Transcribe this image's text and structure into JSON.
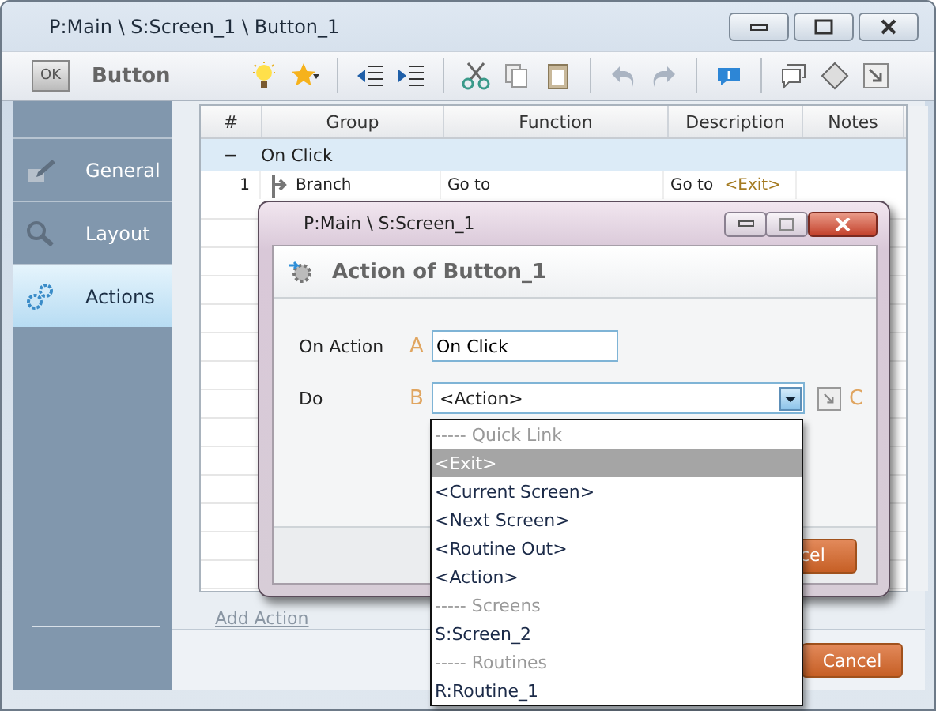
{
  "window": {
    "title": "P:Main \\ S:Screen_1 \\ Button_1"
  },
  "toolbar": {
    "object_icon_label": "OK",
    "object_name": "Button"
  },
  "sidebar": {
    "items": [
      {
        "label": "General",
        "selected": false,
        "kind": "general"
      },
      {
        "label": "Layout",
        "selected": false,
        "kind": "layout"
      },
      {
        "label": "Actions",
        "selected": true,
        "kind": "actions"
      }
    ]
  },
  "table": {
    "columns": [
      "#",
      "Group",
      "Function",
      "Description",
      "Notes"
    ],
    "groups": [
      {
        "label": "On Click",
        "expanded": true,
        "toggle": "−",
        "rows": [
          {
            "number": "1",
            "group": "Branch",
            "function": "Go to",
            "description": "Go to",
            "description_target": "<Exit>"
          }
        ]
      }
    ]
  },
  "add_action_link": "Add Action",
  "cancel_button": "Cancel",
  "dialog": {
    "title": "P:Main \\ S:Screen_1",
    "heading": "Action of Button_1",
    "on_action": {
      "label": "On Action",
      "marker": "A",
      "value": "On Click"
    },
    "do": {
      "label": "Do",
      "marker": "B",
      "value": "<Action>",
      "side_marker": "C"
    },
    "cancel_button": "cel",
    "dropdown": [
      {
        "kind": "header",
        "label": "----- Quick Link",
        "selected": false
      },
      {
        "kind": "option",
        "label": "<Exit>",
        "selected": true
      },
      {
        "kind": "option",
        "label": "<Current Screen>",
        "selected": false
      },
      {
        "kind": "option",
        "label": "<Next Screen>",
        "selected": false
      },
      {
        "kind": "option",
        "label": "<Routine Out>",
        "selected": false
      },
      {
        "kind": "option",
        "label": "<Action>",
        "selected": false
      },
      {
        "kind": "header",
        "label": "----- Screens",
        "selected": false
      },
      {
        "kind": "option",
        "label": "S:Screen_2",
        "selected": false
      },
      {
        "kind": "header",
        "label": "----- Routines",
        "selected": false
      },
      {
        "kind": "option",
        "label": "R:Routine_1",
        "selected": false
      }
    ]
  }
}
